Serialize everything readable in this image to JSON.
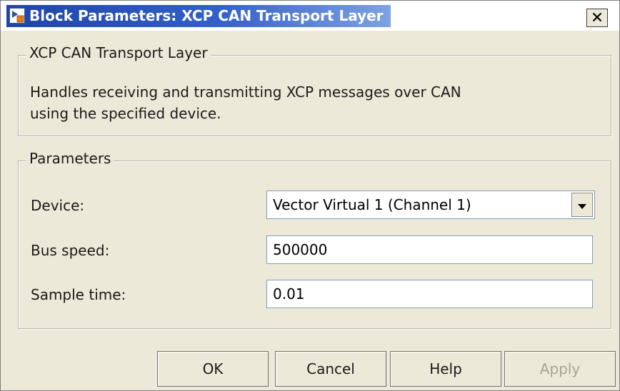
{
  "window": {
    "title": "Block Parameters: XCP CAN Transport Layer"
  },
  "description_group": {
    "legend": "XCP CAN Transport Layer",
    "line1": "Handles receiving and transmitting XCP messages over CAN",
    "line2": "using the specified device."
  },
  "parameters_group": {
    "legend": "Parameters",
    "device_label": "Device:",
    "device_value": "Vector Virtual 1 (Channel 1)",
    "bus_speed_label": "Bus speed:",
    "bus_speed_value": "500000",
    "sample_time_label": "Sample time:",
    "sample_time_value": "0.01"
  },
  "buttons": {
    "ok": "OK",
    "cancel": "Cancel",
    "help": "Help",
    "apply": "Apply",
    "apply_enabled": false
  },
  "icons": {
    "app": "simulink-block-icon",
    "close": "close-icon",
    "dropdown": "chevron-down-icon"
  },
  "colors": {
    "titlebar_accent": "#1e44a8",
    "dialog_background": "#ece9d8",
    "disabled_text": "#a6a49a"
  }
}
